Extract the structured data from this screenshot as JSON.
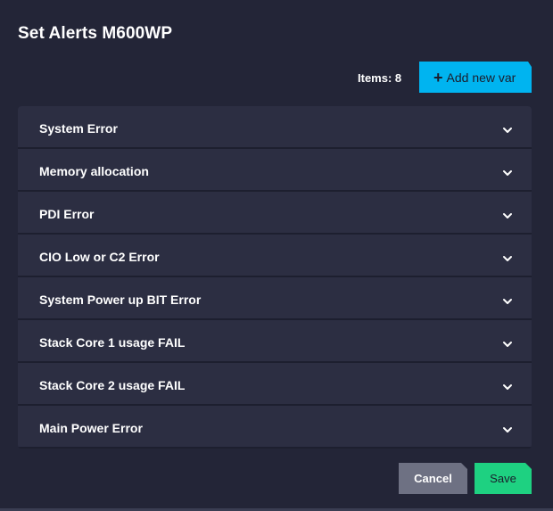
{
  "dialog": {
    "title": "Set Alerts M600WP",
    "items_count": "Items: 8",
    "add_button_label": "Add new var"
  },
  "alerts": [
    {
      "label": "System Error"
    },
    {
      "label": "Memory allocation"
    },
    {
      "label": "PDI Error"
    },
    {
      "label": "CIO Low or C2 Error"
    },
    {
      "label": "System Power up BIT Error"
    },
    {
      "label": "Stack Core 1 usage FAIL"
    },
    {
      "label": "Stack Core 2 usage FAIL"
    },
    {
      "label": "Main Power Error"
    }
  ],
  "footer": {
    "cancel_label": "Cancel",
    "save_label": "Save"
  },
  "colors": {
    "background": "#232537",
    "row": "#2c2e42",
    "accent_blue": "#00b4f0",
    "save_green": "#1ed181",
    "cancel_gray": "#6e7183"
  },
  "icons": {
    "add": "plus-icon",
    "expand": "chevron-down-icon"
  }
}
